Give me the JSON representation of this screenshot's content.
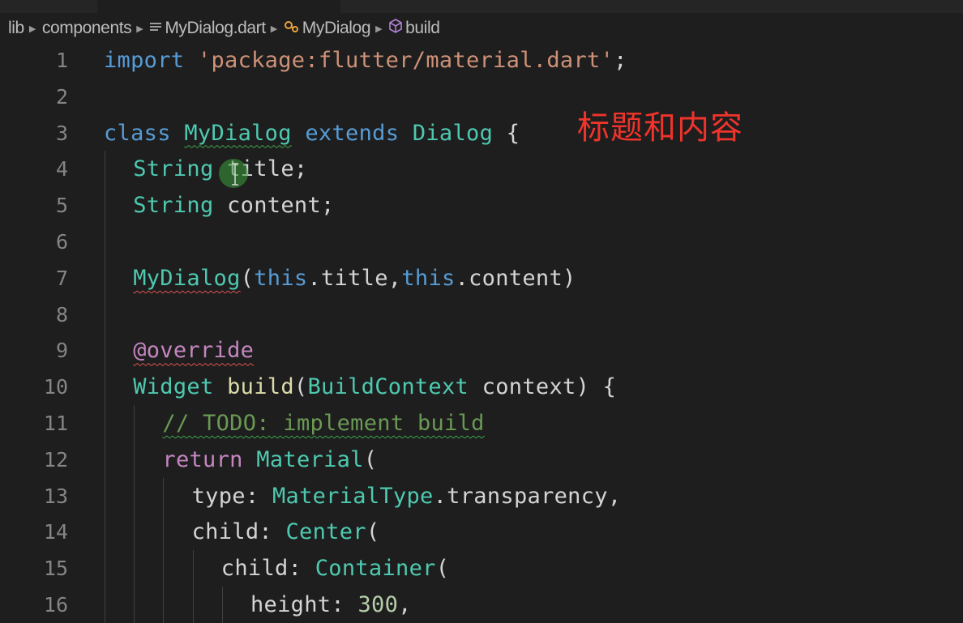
{
  "breadcrumb": {
    "items": [
      {
        "label": "lib",
        "icon": ""
      },
      {
        "label": "components",
        "icon": ""
      },
      {
        "label": "MyDialog.dart",
        "icon": "file-lines-icon"
      },
      {
        "label": "MyDialog",
        "icon": "class-icon"
      },
      {
        "label": "build",
        "icon": "method-cube-icon"
      }
    ]
  },
  "annotation": "标题和内容",
  "lines": [
    {
      "num": "1",
      "indent": 0,
      "tokens": [
        {
          "t": "import",
          "c": "kw-blue"
        },
        {
          "t": " ",
          "c": "punc"
        },
        {
          "t": "'package:flutter/material.dart'",
          "c": "str"
        },
        {
          "t": ";",
          "c": "punc"
        }
      ]
    },
    {
      "num": "2",
      "indent": 0,
      "tokens": []
    },
    {
      "num": "3",
      "indent": 0,
      "tokens": [
        {
          "t": "class",
          "c": "kw-blue"
        },
        {
          "t": " ",
          "c": "punc"
        },
        {
          "t": "MyDialog",
          "c": "type squiggle-green"
        },
        {
          "t": " ",
          "c": "punc"
        },
        {
          "t": "extends",
          "c": "kw-blue"
        },
        {
          "t": " ",
          "c": "punc"
        },
        {
          "t": "Dialog",
          "c": "type"
        },
        {
          "t": " {",
          "c": "punc"
        }
      ]
    },
    {
      "num": "4",
      "indent": 1,
      "tokens": [
        {
          "t": "String",
          "c": "type"
        },
        {
          "t": " ",
          "c": "punc"
        },
        {
          "t": "title",
          "c": "punc"
        },
        {
          "t": ";",
          "c": "punc"
        }
      ]
    },
    {
      "num": "5",
      "indent": 1,
      "tokens": [
        {
          "t": "String",
          "c": "type"
        },
        {
          "t": " ",
          "c": "punc"
        },
        {
          "t": "content",
          "c": "punc"
        },
        {
          "t": ";",
          "c": "punc"
        }
      ]
    },
    {
      "num": "6",
      "indent": 1,
      "tokens": []
    },
    {
      "num": "7",
      "indent": 1,
      "tokens": [
        {
          "t": "MyDialog",
          "c": "type squiggle-red"
        },
        {
          "t": "(",
          "c": "punc"
        },
        {
          "t": "this",
          "c": "kw-blue"
        },
        {
          "t": ".title,",
          "c": "punc"
        },
        {
          "t": "this",
          "c": "kw-blue"
        },
        {
          "t": ".content)",
          "c": "punc"
        }
      ]
    },
    {
      "num": "8",
      "indent": 1,
      "tokens": []
    },
    {
      "num": "9",
      "indent": 1,
      "tokens": [
        {
          "t": "@override",
          "c": "kw-purple squiggle-red"
        }
      ]
    },
    {
      "num": "10",
      "indent": 1,
      "tokens": [
        {
          "t": "Widget",
          "c": "type"
        },
        {
          "t": " ",
          "c": "punc"
        },
        {
          "t": "build",
          "c": "fn"
        },
        {
          "t": "(",
          "c": "punc"
        },
        {
          "t": "BuildContext",
          "c": "type"
        },
        {
          "t": " ",
          "c": "punc"
        },
        {
          "t": "context",
          "c": "punc"
        },
        {
          "t": ") {",
          "c": "punc"
        }
      ]
    },
    {
      "num": "11",
      "indent": 2,
      "tokens": [
        {
          "t": "// TODO: implement build",
          "c": "comment squiggle-green"
        }
      ]
    },
    {
      "num": "12",
      "indent": 2,
      "tokens": [
        {
          "t": "return",
          "c": "kw-purple"
        },
        {
          "t": " ",
          "c": "punc"
        },
        {
          "t": "Material",
          "c": "type"
        },
        {
          "t": "(",
          "c": "punc"
        }
      ]
    },
    {
      "num": "13",
      "indent": 3,
      "tokens": [
        {
          "t": "type",
          "c": "punc"
        },
        {
          "t": ": ",
          "c": "punc"
        },
        {
          "t": "MaterialType",
          "c": "type"
        },
        {
          "t": ".transparency,",
          "c": "punc"
        }
      ]
    },
    {
      "num": "14",
      "indent": 3,
      "tokens": [
        {
          "t": "child",
          "c": "punc"
        },
        {
          "t": ": ",
          "c": "punc"
        },
        {
          "t": "Center",
          "c": "type"
        },
        {
          "t": "(",
          "c": "punc"
        }
      ]
    },
    {
      "num": "15",
      "indent": 4,
      "tokens": [
        {
          "t": "child",
          "c": "punc"
        },
        {
          "t": ": ",
          "c": "punc"
        },
        {
          "t": "Container",
          "c": "type"
        },
        {
          "t": "(",
          "c": "punc"
        }
      ]
    },
    {
      "num": "16",
      "indent": 5,
      "tokens": [
        {
          "t": "height",
          "c": "punc"
        },
        {
          "t": ": ",
          "c": "punc"
        },
        {
          "t": "300",
          "c": "num"
        },
        {
          "t": ",",
          "c": "punc"
        }
      ]
    }
  ]
}
